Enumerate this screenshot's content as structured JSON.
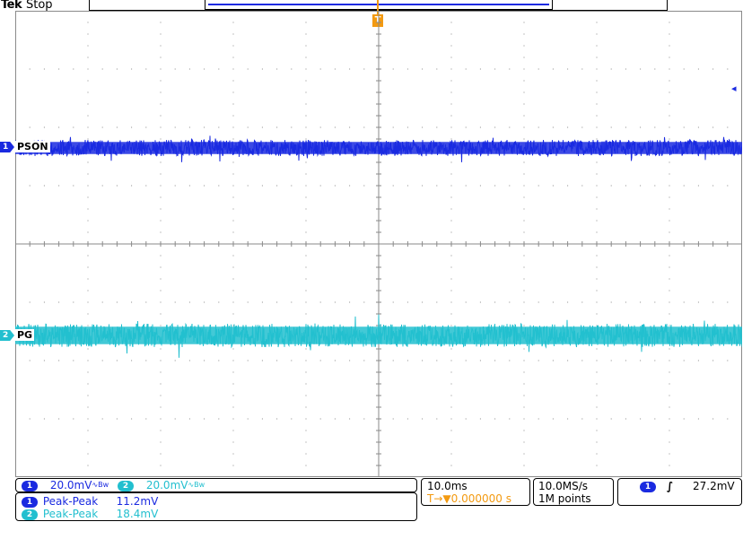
{
  "header": {
    "brand": "Tek",
    "status": "Stop"
  },
  "trigger_position_marker": "T",
  "trigger_level_icon": "◂",
  "channels": [
    {
      "id": "1",
      "name": "PSON",
      "color": "#1a2ae0"
    },
    {
      "id": "2",
      "name": "PG",
      "color": "#22bfcf"
    }
  ],
  "vertical": {
    "ch1_scale": "20.0mV",
    "ch2_scale": "20.0mV",
    "bw_limit_icon": "∿Bw"
  },
  "measurements": [
    {
      "channel": "1",
      "label": "Peak-Peak",
      "value": "11.2mV"
    },
    {
      "channel": "2",
      "label": "Peak-Peak",
      "value": "18.4mV"
    }
  ],
  "timebase": {
    "scale": "10.0ms",
    "position_prefix": "T→▼",
    "position": "0.000000 s"
  },
  "acquisition": {
    "sample_rate": "10.0MS/s",
    "record_length": "1M points"
  },
  "trigger": {
    "source": "1",
    "slope_icon": "∫",
    "level": "27.2mV"
  },
  "colors": {
    "ch1": "#1a2ae0",
    "ch2": "#22bfcf",
    "trigger": "#f39a11",
    "grid": "#8a8a8a"
  }
}
